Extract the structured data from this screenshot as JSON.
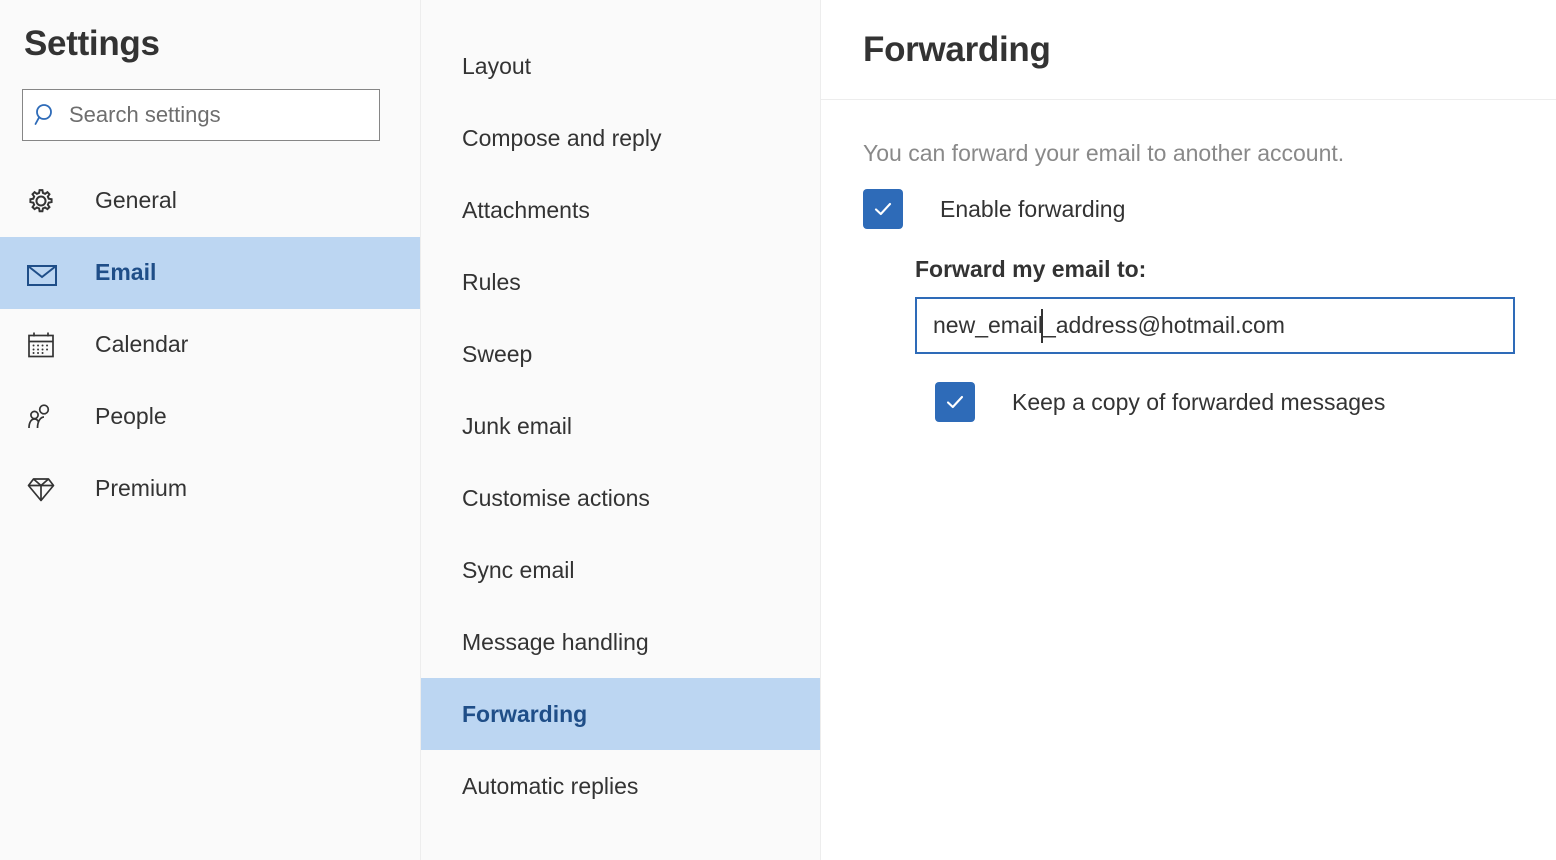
{
  "sidebar": {
    "title": "Settings",
    "search": {
      "placeholder": "Search settings",
      "value": "",
      "icon": "search-icon"
    },
    "items": [
      {
        "label": "General",
        "icon": "gear-icon",
        "selected": false
      },
      {
        "label": "Email",
        "icon": "envelope-icon",
        "selected": true
      },
      {
        "label": "Calendar",
        "icon": "calendar-icon",
        "selected": false
      },
      {
        "label": "People",
        "icon": "people-icon",
        "selected": false
      },
      {
        "label": "Premium",
        "icon": "diamond-icon",
        "selected": false
      }
    ]
  },
  "midnav": {
    "items": [
      {
        "label": "Layout",
        "selected": false
      },
      {
        "label": "Compose and reply",
        "selected": false
      },
      {
        "label": "Attachments",
        "selected": false
      },
      {
        "label": "Rules",
        "selected": false
      },
      {
        "label": "Sweep",
        "selected": false
      },
      {
        "label": "Junk email",
        "selected": false
      },
      {
        "label": "Customise actions",
        "selected": false
      },
      {
        "label": "Sync email",
        "selected": false
      },
      {
        "label": "Message handling",
        "selected": false
      },
      {
        "label": "Forwarding",
        "selected": true
      },
      {
        "label": "Automatic replies",
        "selected": false
      }
    ]
  },
  "main": {
    "title": "Forwarding",
    "description": "You can forward your email to another account.",
    "enable_forwarding": {
      "label": "Enable forwarding",
      "checked": true
    },
    "forward_to": {
      "label": "Forward my email to:",
      "value": "new_email_address@hotmail.com",
      "placeholder": ""
    },
    "keep_copy": {
      "label": "Keep a copy of forwarded messages",
      "checked": true
    }
  },
  "colors": {
    "accent": "#2e6bb8",
    "selection_bg": "#bcd6f2",
    "selection_text": "#1f4e88",
    "panel_bg": "#fafafa",
    "text": "#333333",
    "muted_text": "#898989"
  }
}
